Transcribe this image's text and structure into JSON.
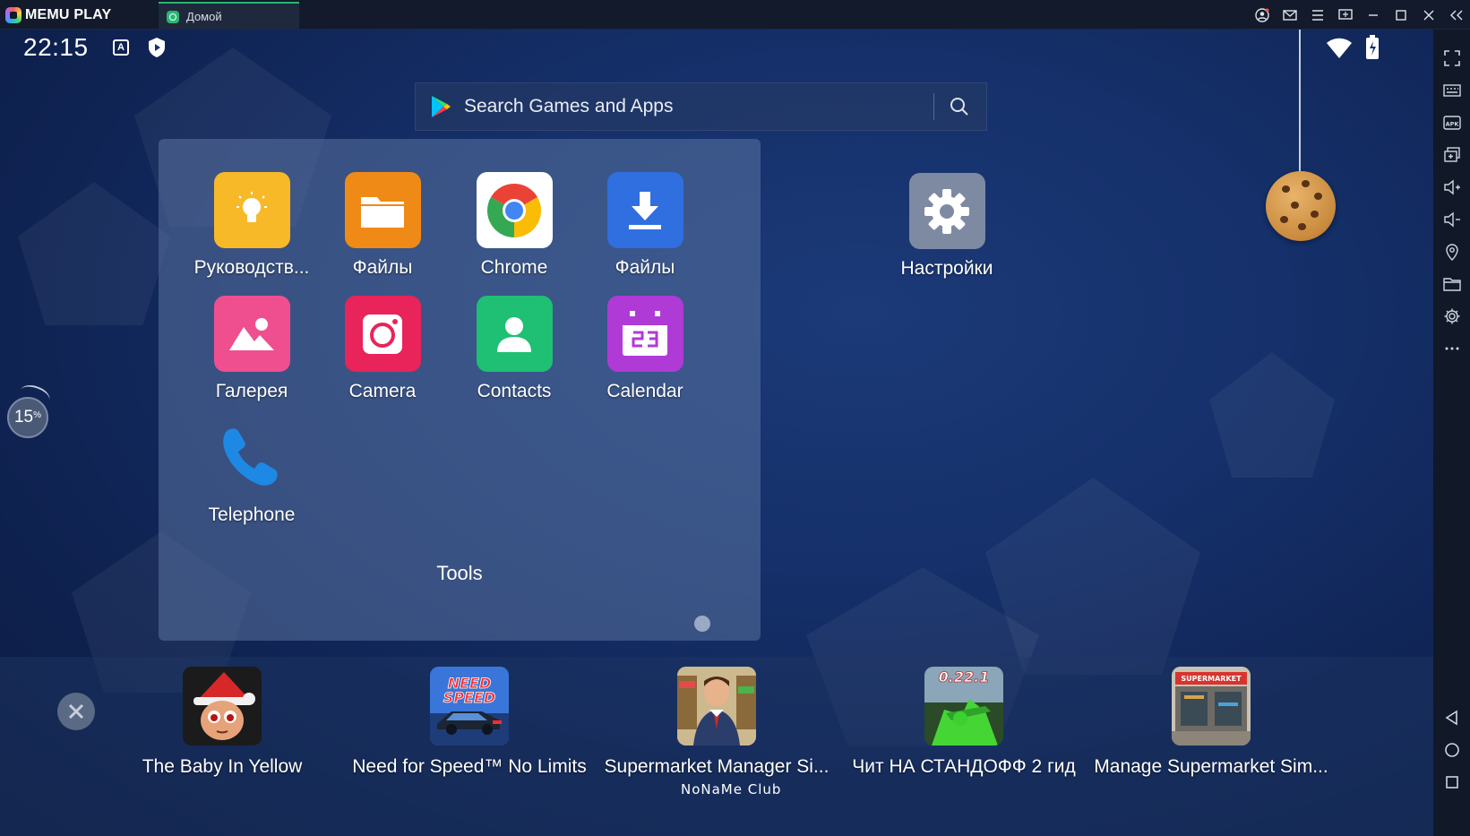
{
  "titlebar": {
    "brand": "MEMU PLAY",
    "tab_label": "Домой"
  },
  "status": {
    "time": "22:15",
    "keyboard_badge": "A"
  },
  "search": {
    "placeholder": "Search Games and Apps"
  },
  "folder": {
    "title": "Tools",
    "apps": [
      {
        "label": "Руководств...",
        "icon": "lightbulb-icon",
        "color": "#f7b928"
      },
      {
        "label": "Файлы",
        "icon": "folder-icon",
        "color": "#f08a16"
      },
      {
        "label": "Chrome",
        "icon": "chrome-icon",
        "color": "#ffffff"
      },
      {
        "label": "Файлы",
        "icon": "download-icon",
        "color": "#2f6fe0"
      },
      {
        "label": "Галерея",
        "icon": "gallery-icon",
        "color": "#ef4f8f"
      },
      {
        "label": "Camera",
        "icon": "camera-icon",
        "color": "#e8245a"
      },
      {
        "label": "Contacts",
        "icon": "contacts-icon",
        "color": "#1fbf74"
      },
      {
        "label": "Calendar",
        "icon": "calendar-icon",
        "color": "#b03ad6"
      },
      {
        "label": "Telephone",
        "icon": "phone-icon",
        "color": "#1e88e5"
      }
    ]
  },
  "desktop": {
    "settings_label": "Настройки"
  },
  "boost": {
    "value": "15",
    "unit": "%"
  },
  "dock": {
    "apps": [
      {
        "label": "The Baby In Yellow",
        "icon": "baby-in-yellow-icon"
      },
      {
        "label": "Need for Speed™ No Limits",
        "icon": "need-for-speed-icon"
      },
      {
        "label": "Supermarket Manager Si...",
        "icon": "supermarket-manager-icon"
      },
      {
        "label": "Чит НА СТАНДОФФ 2 гид",
        "icon": "standoff-guide-icon",
        "badge": "0.22.1"
      },
      {
        "label": "Manage Supermarket Sim...",
        "icon": "manage-supermarket-icon",
        "badge": "SUPERMARKET"
      }
    ],
    "watermark": "NoNaMe Club"
  },
  "sidebar": {
    "items": [
      "fullscreen-icon",
      "keyboard-icon",
      "apk-icon",
      "multi-window-icon",
      "volume-up-icon",
      "volume-down-icon",
      "location-icon",
      "folder-icon",
      "settings-icon",
      "more-icon"
    ],
    "nav": [
      "back-icon",
      "home-icon",
      "recents-icon"
    ]
  }
}
